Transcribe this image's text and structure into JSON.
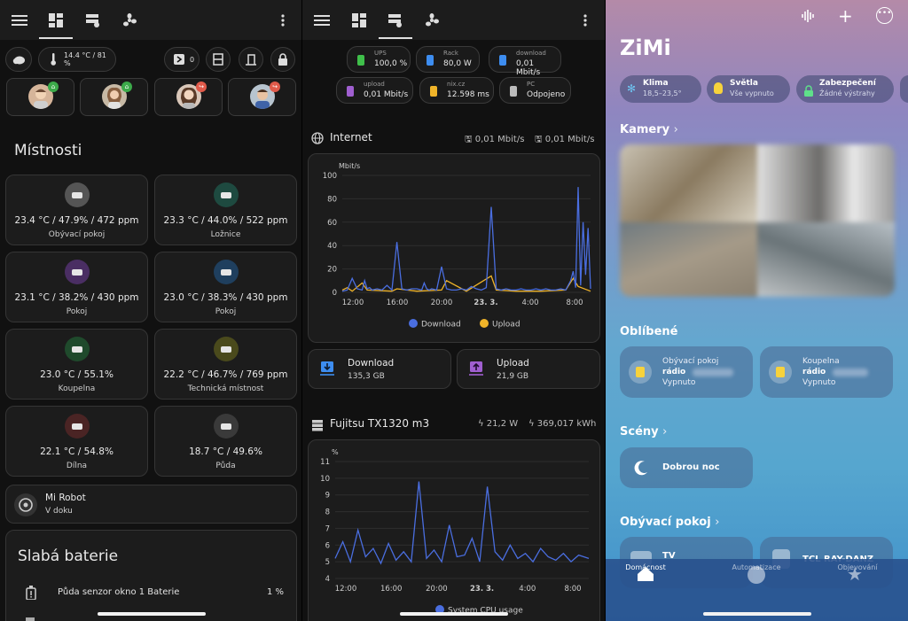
{
  "panel1": {
    "header_chip_temp": "14.4 °C / 81 %",
    "door_count": "0",
    "section_title": "Místnosti",
    "rooms": [
      {
        "value": "23.4 °C / 47.9% / 472 ppm",
        "name": "Obývací pokoj",
        "color": "#555555"
      },
      {
        "value": "23.3 °C / 44.0% / 522 ppm",
        "name": "Ložnice",
        "color": "#1e4a40"
      },
      {
        "value": "23.1 °C / 38.2% / 430 ppm",
        "name": "Pokoj",
        "color": "#4a2e63"
      },
      {
        "value": "23.0 °C / 38.3% / 430 ppm",
        "name": "Pokoj",
        "color": "#1f3f5e"
      },
      {
        "value": "23.0 °C / 55.1%",
        "name": "Koupelna",
        "color": "#1f4a2c"
      },
      {
        "value": "22.2 °C / 46.7% / 769 ppm",
        "name": "Technická místnost",
        "color": "#4a4a1c"
      },
      {
        "value": "22.1 °C / 54.8%",
        "name": "Dílna",
        "color": "#4a2424"
      },
      {
        "value": "18.7 °C / 49.6%",
        "name": "Půda",
        "color": "#3a3a3a"
      }
    ],
    "robot_name": "Mi Robot",
    "robot_status": "V doku",
    "battery_title": "Slabá baterie",
    "battery_item": "Půda senzor okno 1 Baterie",
    "battery_value": "1 %"
  },
  "panel2": {
    "chips_row1": [
      {
        "label": "UPS",
        "value": "100,0 %",
        "color": "#3fbf4a"
      },
      {
        "label": "Rack",
        "value": "80,0 W",
        "color": "#3d8df0"
      },
      {
        "label": "download",
        "value": "0,01 Mbit/s",
        "color": "#3d8df0"
      }
    ],
    "chips_row2": [
      {
        "label": "upload",
        "value": "0,01 Mbit/s",
        "color": "#a05fd0"
      },
      {
        "label": "nix.cz",
        "value": "12.598 ms",
        "color": "#f0b429"
      },
      {
        "label": "PC",
        "value": "Odpojeno",
        "color": "#bbbbbb"
      }
    ],
    "internet_title": "Internet",
    "internet_down": "0,01 Mbit/s",
    "internet_up": "0,01 Mbit/s",
    "download_label": "Download",
    "download_value": "135,3 GB",
    "upload_label": "Upload",
    "upload_value": "21,9 GB",
    "server_title": "Fujitsu TX1320 m3",
    "server_power": "21,2 W",
    "server_energy": "369,017 kWh"
  },
  "chart_data": [
    {
      "type": "line",
      "ylabel": "Mbit/s",
      "ylim": [
        0,
        100
      ],
      "yticks": [
        "100",
        "80",
        "60",
        "40",
        "20",
        "0"
      ],
      "xticks": [
        "12:00",
        "16:00",
        "20:00",
        "23. 3.",
        "4:00",
        "8:00"
      ],
      "legend_position": "bottom",
      "series": [
        {
          "name": "Download",
          "color": "#4a6ee0",
          "x": [
            0,
            2,
            4,
            6,
            8,
            9,
            10,
            11,
            12,
            14,
            16,
            18,
            20,
            22,
            24,
            26,
            28,
            30,
            32,
            33,
            34,
            35,
            36,
            38,
            40,
            42,
            44,
            46,
            48,
            50,
            52,
            54,
            56,
            58,
            60,
            62,
            64,
            66,
            68,
            70,
            72,
            74,
            76,
            78,
            80,
            82,
            84,
            86,
            88,
            90,
            92,
            93,
            94,
            95,
            96,
            97,
            98,
            99,
            100
          ],
          "y": [
            1,
            2,
            12,
            3,
            2,
            10,
            3,
            4,
            2,
            3,
            2,
            6,
            2,
            43,
            3,
            2,
            3,
            3,
            2,
            8,
            3,
            2,
            3,
            2,
            22,
            3,
            2,
            2,
            3,
            2,
            5,
            3,
            2,
            4,
            73,
            3,
            2,
            3,
            2,
            2,
            3,
            2,
            2,
            3,
            2,
            3,
            2,
            2,
            3,
            2,
            10,
            18,
            4,
            90,
            6,
            60,
            15,
            55,
            3
          ]
        },
        {
          "name": "Upload",
          "color": "#f0b429",
          "x": [
            0,
            2,
            4,
            8,
            10,
            20,
            22,
            30,
            40,
            42,
            50,
            60,
            62,
            70,
            80,
            90,
            93,
            95,
            100
          ],
          "y": [
            2,
            4,
            1,
            8,
            2,
            1,
            3,
            1,
            2,
            10,
            1,
            14,
            2,
            1,
            1,
            2,
            12,
            5,
            1
          ]
        }
      ]
    },
    {
      "type": "line",
      "ylabel": "%",
      "ylim": [
        4,
        11
      ],
      "yticks": [
        "11",
        "10",
        "9",
        "8",
        "7",
        "6",
        "5",
        "4"
      ],
      "xticks": [
        "12:00",
        "16:00",
        "20:00",
        "23. 3.",
        "4:00",
        "8:00"
      ],
      "legend_position": "bottom",
      "series": [
        {
          "name": "System CPU usage",
          "color": "#4a6ee0",
          "x": [
            0,
            3,
            6,
            9,
            12,
            15,
            18,
            21,
            24,
            27,
            30,
            33,
            36,
            39,
            42,
            45,
            48,
            51,
            54,
            57,
            60,
            63,
            66,
            69,
            72,
            75,
            78,
            81,
            84,
            87,
            90,
            93,
            96,
            100
          ],
          "y": [
            5.2,
            6.2,
            5.0,
            6.9,
            5.3,
            5.8,
            4.9,
            6.1,
            5.1,
            5.6,
            5.0,
            9.8,
            5.2,
            5.7,
            5.0,
            7.2,
            5.3,
            5.4,
            6.4,
            5.0,
            9.5,
            5.6,
            5.1,
            6.0,
            5.2,
            5.5,
            5.0,
            5.8,
            5.3,
            5.1,
            5.5,
            5.0,
            5.4,
            5.2
          ]
        }
      ]
    }
  ],
  "panel3": {
    "home_title": "ZiMi",
    "pills": [
      {
        "title": "Klima",
        "sub": "18,5–23,5°"
      },
      {
        "title": "Světla",
        "sub": "Vše vypnuto"
      },
      {
        "title": "Zabezpečení",
        "sub": "Žádné výstrahy"
      }
    ],
    "section_cameras": "Kamery",
    "section_favorites": "Oblíbené",
    "fav1_room": "Obývací pokoj",
    "fav1_name": "rádio",
    "fav1_status": "Vypnuto",
    "fav2_room": "Koupelna",
    "fav2_name": "rádio",
    "fav2_status": "Vypnuto",
    "section_scenes": "Scény",
    "scene1": "Dobrou noc",
    "section_living": "Obývací pokoj",
    "living_tile1": "TV",
    "living_tile2": "TCL RAY-DANZ",
    "tabs": [
      "Domácnost",
      "Automatizace",
      "Objevování"
    ]
  }
}
